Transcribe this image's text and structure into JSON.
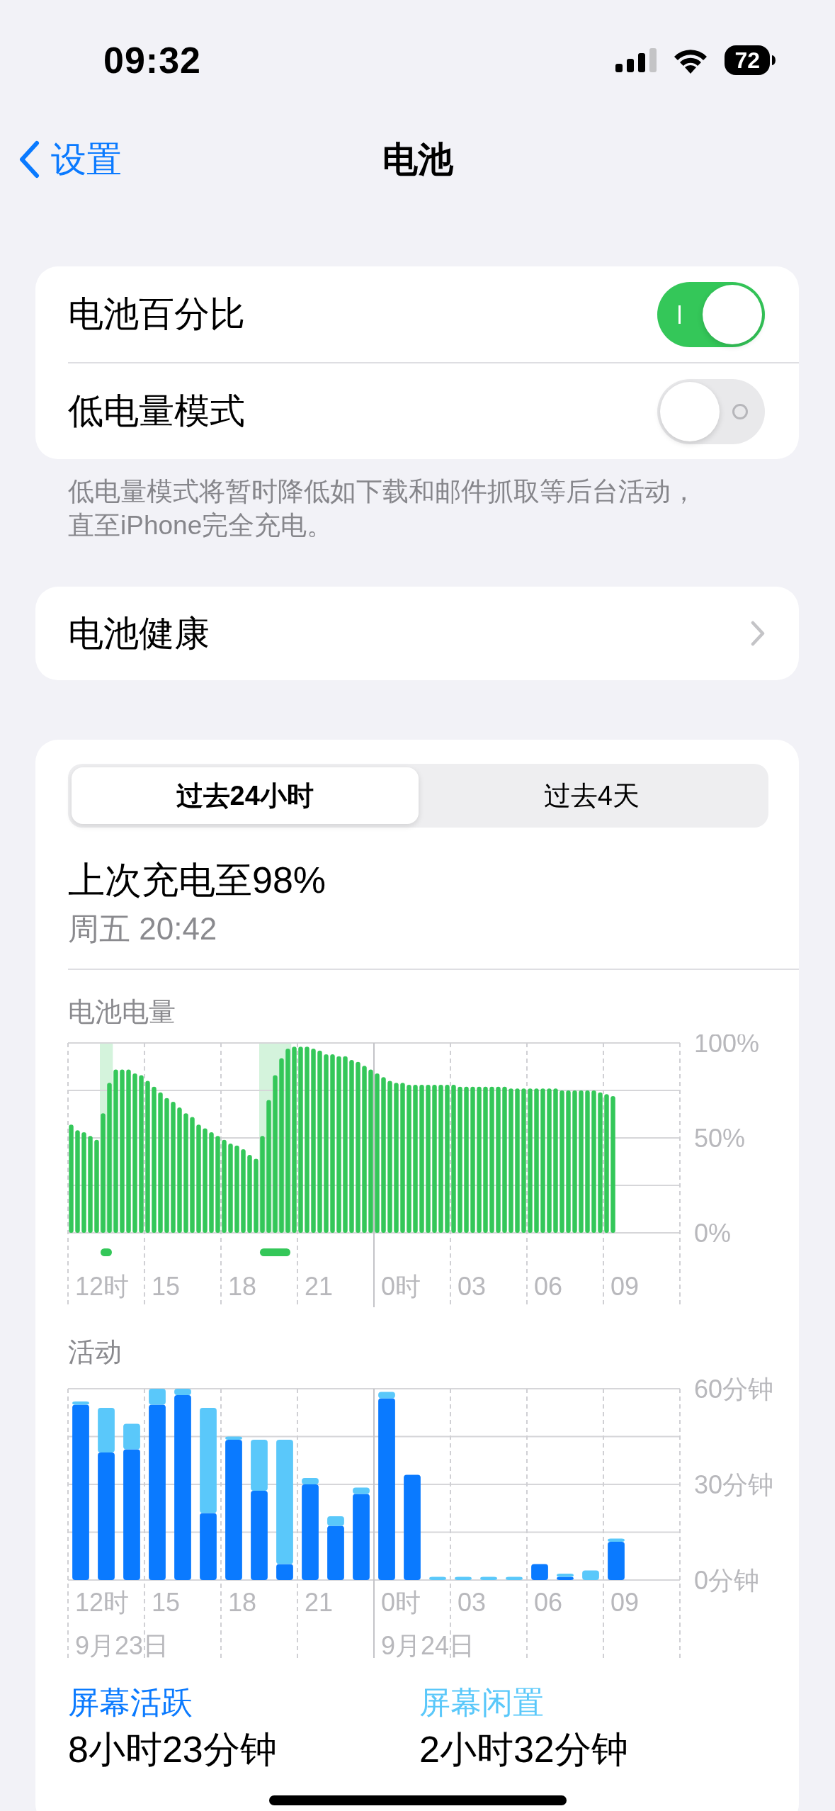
{
  "status_bar": {
    "time": "09:32",
    "battery": "72"
  },
  "nav": {
    "back": "设置",
    "title": "电池"
  },
  "settings": [
    {
      "label": "电池百分比",
      "on": true
    },
    {
      "label": "低电量模式",
      "on": false
    }
  ],
  "settings_footnote": "低电量模式将暂时降低如下载和邮件抓取等后台活动，直至iPhone完全充电。",
  "battery_health": {
    "label": "电池健康"
  },
  "usage": {
    "tabs": [
      {
        "label": "过去24小时",
        "selected": true
      },
      {
        "label": "过去4天",
        "selected": false
      }
    ],
    "last_charge": "上次充电至98%",
    "last_charge_time": "周五 20:42",
    "battery_level": {
      "title": "电池电量",
      "hour_labels": [
        {
          "label": "12时",
          "day_start": false
        },
        {
          "label": "15",
          "day_start": false
        },
        {
          "label": "18",
          "day_start": false
        },
        {
          "label": "21",
          "day_start": false
        },
        {
          "label": "0时",
          "day_start": true
        },
        {
          "label": "03",
          "day_start": false
        },
        {
          "label": "06",
          "day_start": false
        },
        {
          "label": "09",
          "day_start": false
        }
      ],
      "charging": [
        false,
        false,
        false,
        false,
        false,
        true,
        true,
        false,
        false,
        false,
        false,
        false,
        false,
        false,
        false,
        false,
        false,
        false,
        false,
        false,
        false,
        false,
        false,
        false,
        false,
        false,
        false,
        false,
        false,
        false,
        true,
        true,
        true,
        true,
        true,
        false,
        false,
        false,
        false,
        false,
        false,
        false,
        false,
        false,
        false,
        false,
        false,
        false,
        false,
        false,
        false,
        false,
        false,
        false,
        false,
        false,
        false,
        false,
        false,
        false,
        false,
        false,
        false,
        false,
        false,
        false,
        false,
        false,
        false,
        false,
        false,
        false,
        false,
        false,
        false,
        false,
        false,
        false,
        false,
        false,
        false,
        false,
        false,
        false,
        false,
        false
      ],
      "chart_data": {
        "type": "bar",
        "series": [
          {
            "color": "#34c759",
            "values": [
              57,
              54,
              53,
              51,
              49,
              63,
              79,
              86,
              86,
              86,
              84,
              83,
              80,
              77,
              74,
              71,
              69,
              66,
              63,
              61,
              57,
              55,
              53,
              51,
              49,
              47,
              46,
              44,
              41,
              39,
              51,
              70,
              83,
              92,
              97,
              98,
              98,
              98,
              97,
              96,
              94,
              94,
              93,
              93,
              91,
              90,
              88,
              86,
              84,
              82,
              80,
              79,
              79,
              78,
              78,
              78,
              78,
              78,
              78,
              78,
              78,
              77,
              77,
              77,
              77,
              77,
              77,
              77,
              77,
              76,
              76,
              76,
              76,
              76,
              76,
              76,
              76,
              75,
              75,
              75,
              75,
              75,
              75,
              74,
              73,
              72
            ]
          }
        ],
        "ylim": [
          0,
          100
        ],
        "yticks": [
          {
            "value": 0,
            "label": "0%"
          },
          {
            "value": 50,
            "label": "50%"
          },
          {
            "value": 100,
            "label": "100%"
          }
        ]
      }
    },
    "activity": {
      "title": "活动",
      "hour_labels": [
        {
          "label": "12时",
          "day_start": false,
          "date": "9月23日"
        },
        {
          "label": "15",
          "day_start": false
        },
        {
          "label": "18",
          "day_start": false
        },
        {
          "label": "21",
          "day_start": false
        },
        {
          "label": "0时",
          "day_start": true,
          "date": "9月24日"
        },
        {
          "label": "03",
          "day_start": false
        },
        {
          "label": "06",
          "day_start": false
        },
        {
          "label": "09",
          "day_start": false
        }
      ],
      "chart_data": {
        "type": "bar",
        "stacked": true,
        "series": [
          {
            "color": "#0a7aff",
            "values": [
              55,
              40,
              41,
              55,
              58,
              21,
              44,
              28,
              5,
              30,
              17,
              27,
              57,
              33,
              0,
              0,
              0,
              0,
              5,
              1,
              0,
              12
            ]
          },
          {
            "color": "#5ac8fa",
            "values": [
              1,
              14,
              8,
              5,
              2,
              33,
              1,
              16,
              39,
              2,
              3,
              2,
              2,
              0,
              1,
              1,
              1,
              1,
              0,
              1,
              3,
              1
            ]
          }
        ],
        "ylim": [
          0,
          60
        ],
        "yticks": [
          {
            "value": 0,
            "label": "0分钟"
          },
          {
            "value": 30,
            "label": "30分钟"
          },
          {
            "value": 60,
            "label": "60分钟"
          }
        ]
      }
    },
    "legend": [
      {
        "label": "屏幕活跃",
        "value": "8小时23分钟",
        "color": "#0a7aff"
      },
      {
        "label": "屏幕闲置",
        "value": "2小时32分钟",
        "color": "#5ac8fa"
      }
    ]
  }
}
